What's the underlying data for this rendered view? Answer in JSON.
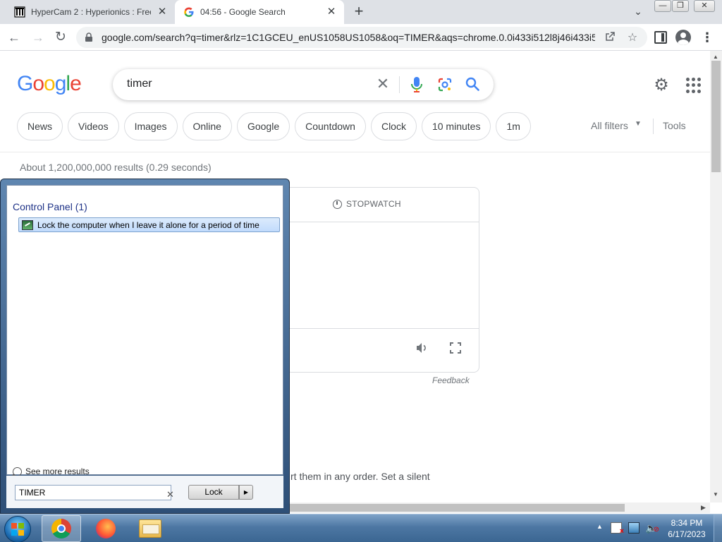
{
  "tabs": [
    {
      "title": "HyperCam 2 : Hyperionics : Free",
      "icon": "archive-icon"
    },
    {
      "title": "04:56 - Google Search",
      "icon": "google-g-icon"
    }
  ],
  "tab_close_glyph": "✕",
  "new_tab_glyph": "+",
  "window_controls": {
    "minimize": "—",
    "maximize": "❐",
    "close": "✕"
  },
  "address_bar": {
    "url": "google.com/search?q=timer&rlz=1C1GCEU_enUS1058US1058&oq=TIMER&aqs=chrome.0.0i433i512l8j46i433i5..."
  },
  "google": {
    "logo_letters": [
      "G",
      "o",
      "o",
      "g",
      "l",
      "e"
    ],
    "logo_colors": [
      "#4285F4",
      "#EA4335",
      "#FBBC05",
      "#4285F4",
      "#34A853",
      "#EA4335"
    ],
    "query": "timer",
    "chips": [
      "News",
      "Videos",
      "Images",
      "Online",
      "Google",
      "Countdown",
      "Clock",
      "10 minutes",
      "1m"
    ],
    "all_filters": "All filters",
    "tools": "Tools",
    "result_stats": "About 1,200,000,000 results (0.29 seconds)",
    "timer_widget": {
      "stopwatch_label": "STOPWATCH"
    },
    "feedback": "Feedback",
    "snippet": "rt them in any order. Set a silent"
  },
  "start_menu": {
    "group_title": "Control Panel (1)",
    "result": "Lock the computer when I leave it alone for a period of time",
    "see_more": "See more results",
    "search_value": "TIMER",
    "lock_button": "Lock"
  },
  "taskbar": {
    "apps": [
      "start-button",
      "chrome",
      "firefox",
      "windows-explorer"
    ],
    "time": "8:34 PM",
    "date": "6/17/2023"
  },
  "colors": {
    "google_blue": "#4285F4",
    "chrome_tabstrip": "#DEE1E6",
    "start_menu_highlight": "#C1DBFC",
    "taskbar": "#4D77A3"
  }
}
